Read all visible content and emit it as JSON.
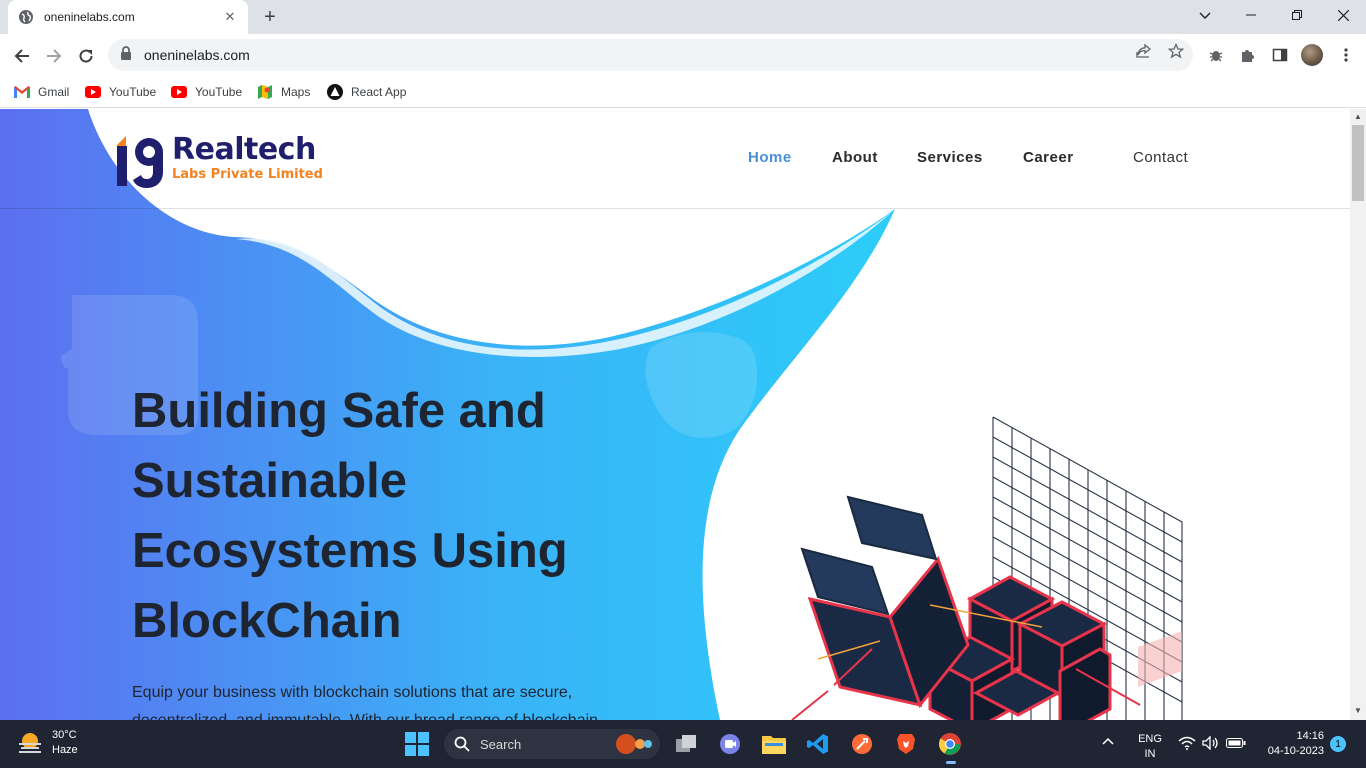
{
  "browser": {
    "tab": {
      "title": "oneninelabs.com"
    },
    "address": "oneninelabs.com",
    "bookmarks": [
      {
        "label": "Gmail",
        "icon": "gmail-icon"
      },
      {
        "label": "YouTube",
        "icon": "youtube-icon"
      },
      {
        "label": "YouTube",
        "icon": "youtube-icon"
      },
      {
        "label": "Maps",
        "icon": "maps-icon"
      },
      {
        "label": "React App",
        "icon": "react-app-icon"
      }
    ]
  },
  "site": {
    "logo": {
      "main": "Realtech",
      "sub": "Labs Private Limited"
    },
    "nav": [
      "Home",
      "About",
      "Services",
      "Career",
      "Contact"
    ],
    "hero": {
      "title_lines": [
        "Building Safe and",
        "Sustainable",
        "Ecosystems Using",
        "BlockChain"
      ],
      "description": "Equip your business with blockchain solutions that are secure, decentralized, and immutable. With our broad range of blockchain"
    },
    "colors": {
      "brand_navy": "#1f1f6e",
      "brand_orange": "#f58220",
      "nav_active": "#4a8fd6",
      "hero_gradient_start": "#5c6ff0",
      "hero_gradient_end": "#2ccdf8"
    }
  },
  "taskbar": {
    "weather": {
      "temp": "30°C",
      "condition": "Haze"
    },
    "search_label": "Search",
    "language": {
      "line1": "ENG",
      "line2": "IN"
    },
    "clock": {
      "time": "14:16",
      "date": "04-10-2023"
    },
    "notification_count": "1"
  }
}
